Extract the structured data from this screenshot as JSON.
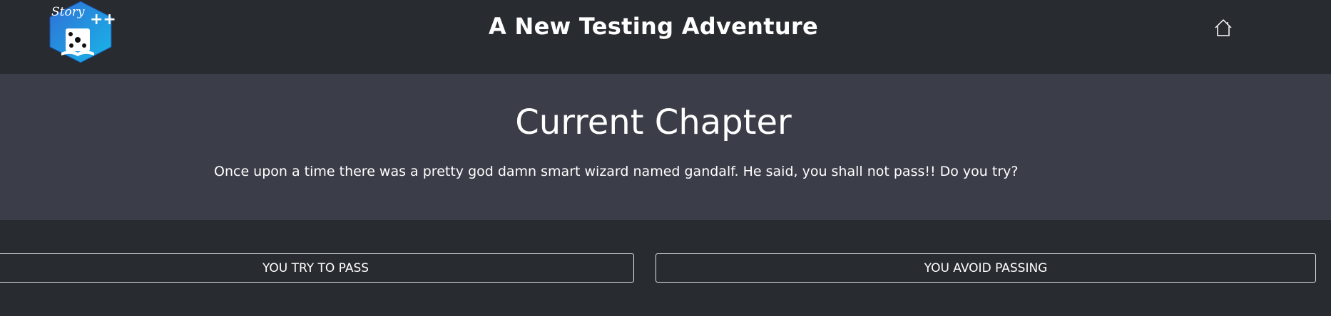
{
  "header": {
    "title": "A New Testing Adventure",
    "logo_text": "Story ++",
    "home_icon": "home-icon"
  },
  "chapter": {
    "heading": "Current Chapter",
    "text": "Once upon a time there was a pretty god damn smart wizard named gandalf. He said, you shall not pass!! Do you try?"
  },
  "choices": [
    {
      "label": "YOU TRY TO PASS"
    },
    {
      "label": "YOU AVOID PASSING"
    }
  ],
  "colors": {
    "page_bg": "#282c30",
    "panel_bg": "#3b3e48",
    "text": "#ffffff",
    "logo_blue": "#1e88e5"
  }
}
